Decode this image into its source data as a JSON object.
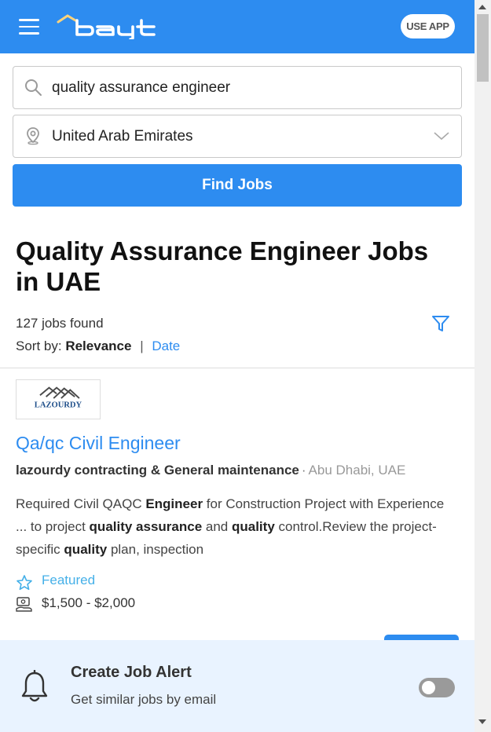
{
  "header": {
    "logo_alt": "bayt",
    "use_app_label": "USE APP",
    "brand_color": "#2d8cf0"
  },
  "search": {
    "keyword_value": "quality assurance engineer",
    "location_value": "United Arab Emirates",
    "find_button_label": "Find Jobs"
  },
  "results": {
    "title": "Quality Assurance Engineer Jobs in UAE",
    "count_text": "127 jobs found",
    "sort_label": "Sort by:",
    "sort_active": "Relevance",
    "sort_separator": "|",
    "sort_other": "Date"
  },
  "job": {
    "company_logo_text": "LAZOURDY",
    "title": "Qa/qc Civil Engineer",
    "company": "lazourdy contracting & General maintenance",
    "separator": "·",
    "location": "Abu Dhabi, UAE",
    "description": [
      {
        "t": "Required Civil QAQC ",
        "b": false
      },
      {
        "t": "Engineer",
        "b": true
      },
      {
        "t": " for Construction Project with Experience ... to project ",
        "b": false
      },
      {
        "t": "quality assurance",
        "b": true
      },
      {
        "t": " and ",
        "b": false
      },
      {
        "t": "quality",
        "b": true
      },
      {
        "t": " control.Review the project-specific ",
        "b": false
      },
      {
        "t": "quality",
        "b": true
      },
      {
        "t": " plan, inspection",
        "b": false
      }
    ],
    "featured_label": "Featured",
    "salary": "$1,500 - $2,000"
  },
  "alert": {
    "title": "Create Job Alert",
    "subtitle": "Get similar jobs by email",
    "toggle_on": false
  },
  "icons": [
    "menu-icon",
    "search-icon",
    "location-pin-icon",
    "chevron-down-icon",
    "filter-icon",
    "star-icon",
    "salary-icon",
    "bell-icon"
  ]
}
